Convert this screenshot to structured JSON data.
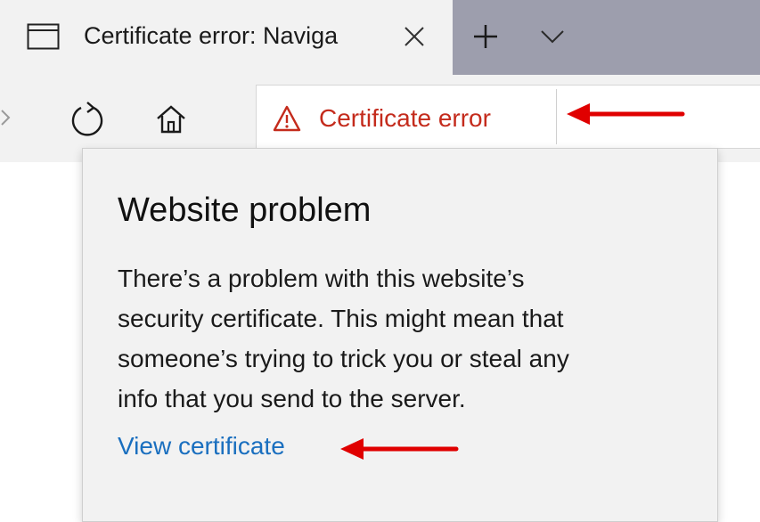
{
  "tab": {
    "title": "Certificate error: Naviga",
    "icon": "tab-page-icon",
    "close_icon": "close-icon"
  },
  "tabstrip": {
    "new_tab_icon": "plus-icon",
    "dropdown_icon": "chevron-down-icon"
  },
  "toolbar": {
    "forward_icon": "forward-arrow-icon",
    "refresh_icon": "refresh-icon",
    "home_icon": "home-icon"
  },
  "address": {
    "warning_icon": "warning-triangle-icon",
    "cert_label": "Certificate error"
  },
  "flyout": {
    "title": "Website problem",
    "body_lines": [
      "There’s a problem with this website’s",
      "security certificate. This might mean that",
      "someone’s trying to trick you or steal any",
      "info that you send to the server."
    ],
    "link": "View certificate"
  },
  "annotations": {
    "arrow_color": "#e00000"
  },
  "colors": {
    "error_red": "#c42b1c",
    "link_blue": "#1a6fbf",
    "inactive_tab_bg": "#9d9ead",
    "chrome_bg": "#f2f2f2"
  }
}
